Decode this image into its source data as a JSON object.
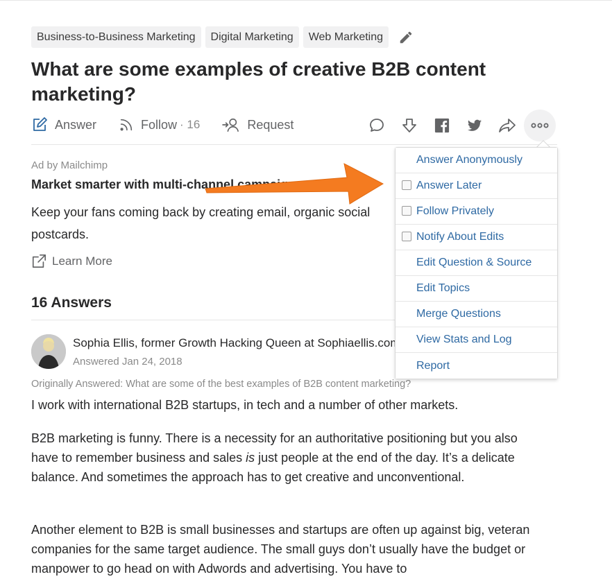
{
  "topics": [
    "Business-to-Business Marketing",
    "Digital Marketing",
    "Web Marketing"
  ],
  "question": "What are some examples of creative B2B content marketing?",
  "actions": {
    "answer_label": "Answer",
    "follow_label": "Follow",
    "follow_count": "· 16",
    "request_label": "Request"
  },
  "ad": {
    "label": "Ad by Mailchimp",
    "title": "Market smarter with multi-channel campaigns.",
    "body_line1": "Keep your fans coming back by creating email, organic social",
    "body_line2": "postcards.",
    "learn_more": "Learn More"
  },
  "answers_header": "16 Answers",
  "answer": {
    "author": "Sophia Ellis, former Growth Hacking Queen at Sophiaellis.com",
    "date": "Answered Jan 24, 2018",
    "originally": "Originally Answered: What are some of the best examples of B2B content marketing?",
    "p1": "I work with international B2B startups, in tech and a number of other markets.",
    "p2a": "B2B marketing is funny. There is a necessity for an authoritative positioning but you also have to remember business and sales ",
    "p2_em": "is",
    "p2b": " just people at the end of the day. It’s a delicate balance. And sometimes the approach has to get creative and unconventional.",
    "p3": "Another element to B2B is small businesses and startups are often up against big, veteran companies for the same target audience. The small guys don’t usually have the budget or manpower to go head on with Adwords and advertising. You have to"
  },
  "menu": {
    "items": [
      {
        "label": "Answer Anonymously",
        "checkbox": false
      },
      {
        "label": "Answer Later",
        "checkbox": true
      },
      {
        "label": "Follow Privately",
        "checkbox": true
      },
      {
        "label": "Notify About Edits",
        "checkbox": true
      },
      {
        "label": "Edit Question & Source",
        "checkbox": false
      },
      {
        "label": "Edit Topics",
        "checkbox": false
      },
      {
        "label": "Merge Questions",
        "checkbox": false
      },
      {
        "label": "View Stats and Log",
        "checkbox": false
      },
      {
        "label": "Report",
        "checkbox": false
      }
    ]
  },
  "icons": {
    "answer": "pencil-square-icon",
    "follow": "rss-icon",
    "request": "request-user-icon",
    "comment": "comment-icon",
    "downvote": "downvote-icon",
    "facebook": "facebook-icon",
    "twitter": "twitter-icon",
    "share": "share-icon",
    "more": "more-dots-icon"
  },
  "colors": {
    "link_blue": "#2e69a3",
    "arrow_orange": "#f47b20",
    "answer_blue": "#2e69a3"
  }
}
